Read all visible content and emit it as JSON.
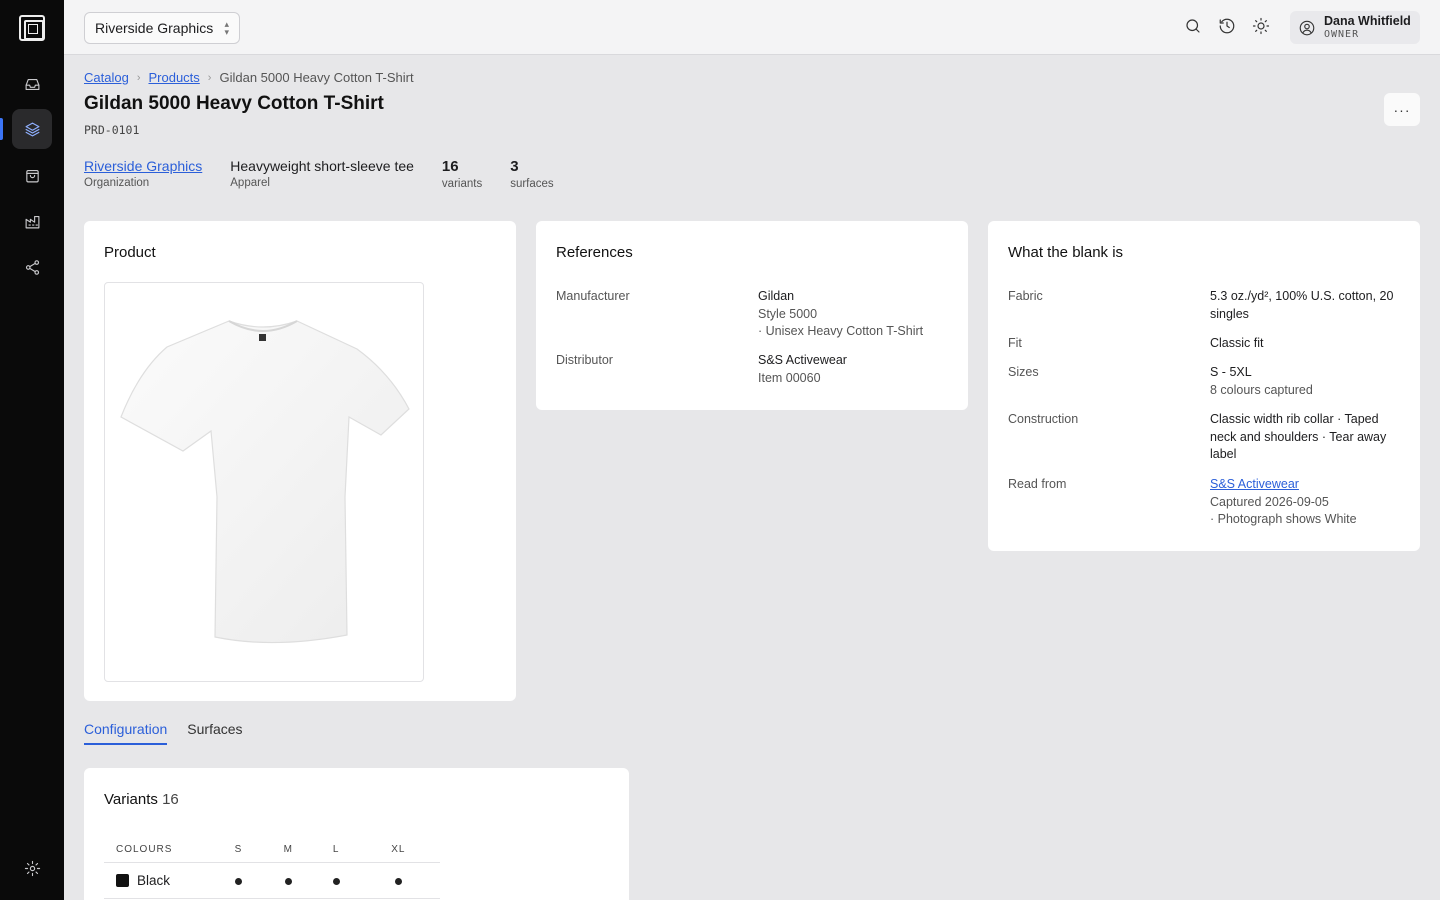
{
  "app": {
    "brand_color": "#3b74f5",
    "link_color": "#2b5fd9"
  },
  "topbar": {
    "org_name": "Riverside Graphics",
    "user_name": "Dana Whitfield",
    "user_role": "OWNER"
  },
  "breadcrumb": {
    "items": [
      "Catalog",
      "Products",
      "Gildan 5000 Heavy Cotton T-Shirt"
    ]
  },
  "page": {
    "title": "Gildan 5000 Heavy Cotton T-Shirt",
    "sku": "PRD-0101",
    "more_label": "···"
  },
  "stats": [
    {
      "value": "Riverside Graphics",
      "label": "Organization"
    },
    {
      "value": "Heavyweight short-sleeve tee",
      "label": "Apparel"
    },
    {
      "value": "16",
      "label": "variants"
    },
    {
      "value": "3",
      "label": "surfaces"
    }
  ],
  "product_card": {
    "title": "Product"
  },
  "references": {
    "title": "References",
    "rows": [
      {
        "key": "Manufacturer",
        "lines": [
          "Gildan",
          "Style 5000",
          "· Unisex Heavy Cotton T-Shirt"
        ]
      },
      {
        "key": "Distributor",
        "lines": [
          "S&S Activewear",
          "Item 00060"
        ]
      }
    ]
  },
  "blank": {
    "title": "What the blank is",
    "fabric_key": "Fabric",
    "fabric": "5.3 oz./yd², 100% U.S. cotton, 20 singles",
    "fit_key": "Fit",
    "fit": "Classic fit",
    "sizes_key": "Sizes",
    "sizes": "S - 5XL",
    "sizes_sub": "8 colours captured",
    "construction_key": "Construction",
    "construction": "Classic width rib collar · Taped neck and shoulders · Tear away label",
    "read_from_key": "Read from",
    "read_from_link": "S&S Activewear",
    "captured": "Captured 2026-09-05",
    "photo_note": "· Photograph shows White"
  },
  "tabs": [
    "Configuration",
    "Surfaces"
  ],
  "variants": {
    "title": "Variants",
    "count": "16",
    "columns": [
      "COLOURS",
      "S",
      "M",
      "L",
      "XL"
    ],
    "rows": [
      {
        "colour": "Black",
        "swatch": "#111111"
      }
    ]
  }
}
